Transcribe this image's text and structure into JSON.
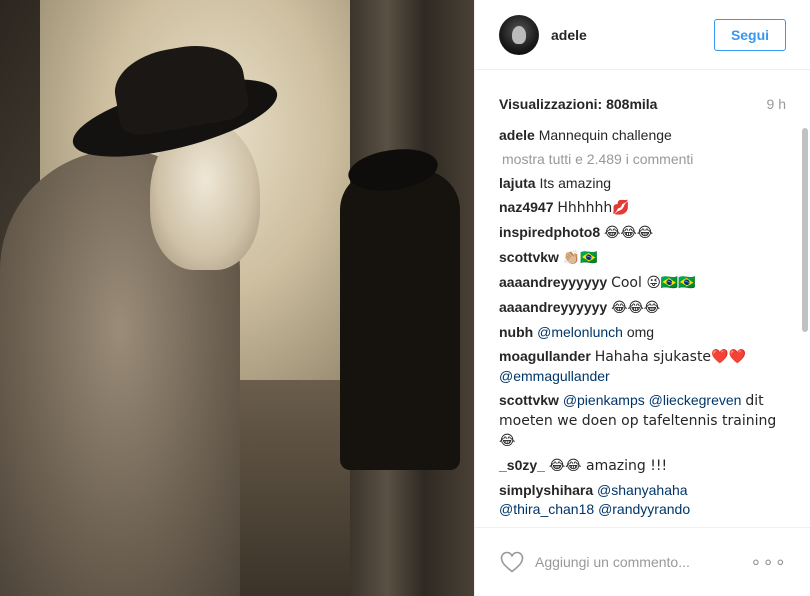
{
  "post": {
    "username": "adele",
    "follow_label": "Segui",
    "views_label": "Visualizzazioni: 808mila",
    "time": "9 h"
  },
  "comments": [
    {
      "user": "adele",
      "text": "Mannequin challenge"
    },
    {
      "more": "mostra tutti e 2.489 i commenti"
    },
    {
      "user": "lajuta",
      "text": "Its amazing"
    },
    {
      "user": "naz4947",
      "text": "Hhhhhh💋"
    },
    {
      "user": "inspiredphoto8",
      "text": "😂😂😂"
    },
    {
      "user": "scottvkw",
      "text": "👏🏼🇧🇷"
    },
    {
      "user": "aaaandreyyyyyy",
      "text": "Cool 😜🇧🇷🇧🇷"
    },
    {
      "user": "aaaandreyyyyyy",
      "text": "😂😂😂"
    },
    {
      "user": "nubh",
      "mention": "@melonlunch",
      "text": "omg"
    },
    {
      "user": "moagullander",
      "text": "Hahaha sjukaste❤️❤️",
      "mention2": "@emmagullander"
    },
    {
      "user": "scottvkw",
      "mention": "@pienkamps",
      "mention2": "@lieckegreven",
      "text": "dit moeten we doen op tafeltennis training 😂"
    },
    {
      "user": "_s0zy_",
      "text": "😂😂 amazing !!!"
    },
    {
      "user": "simplyshihara",
      "mention": "@shanyahaha",
      "mention2": "@thira_chan18",
      "mention3": "@randyyrando"
    }
  ],
  "footer": {
    "comment_placeholder": "Aggiungi un commento...",
    "options_label": "∘∘∘"
  },
  "icons": {
    "heart": "heart-icon",
    "options": "options-icon"
  },
  "colors": {
    "accent": "#3897f0",
    "mention": "#003569",
    "muted": "#999999"
  }
}
